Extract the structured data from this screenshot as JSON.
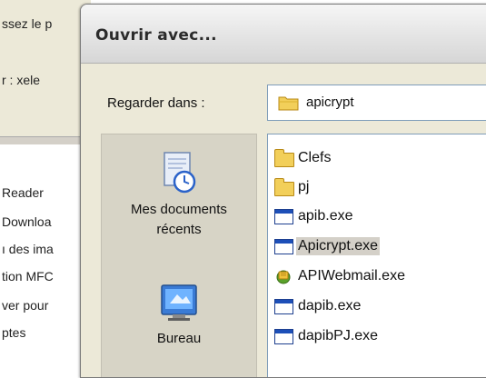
{
  "background_window": {
    "line1": "ssez le p",
    "line2": "r : xele",
    "items": [
      "Reader",
      "Downloa",
      "ı des ima",
      "tion MFC",
      "ver pour",
      "ptes"
    ]
  },
  "dialog": {
    "title": "Ouvrir avec...",
    "look_in_label": "Regarder dans :",
    "look_in_value": "apicrypt",
    "places": [
      {
        "label_line1": "Mes documents",
        "label_line2": "récents",
        "icon": "recent-documents-icon"
      },
      {
        "label_line1": "Bureau",
        "icon": "desktop-icon"
      }
    ],
    "files": [
      {
        "name": "Clefs",
        "type": "folder"
      },
      {
        "name": "pj",
        "type": "folder"
      },
      {
        "name": "apib.exe",
        "type": "exe"
      },
      {
        "name": "Apicrypt.exe",
        "type": "exe",
        "selected": true
      },
      {
        "name": "APIWebmail.exe",
        "type": "exe-webmail"
      },
      {
        "name": "dapib.exe",
        "type": "exe"
      },
      {
        "name": "dapibPJ.exe",
        "type": "exe"
      }
    ]
  },
  "colors": {
    "dialog_bg": "#ece9d8",
    "places_bg": "#d7d4c6",
    "border_blue": "#7f9db9",
    "folder_yellow": "#f2cf5a",
    "selection": "#d4d0c8"
  }
}
